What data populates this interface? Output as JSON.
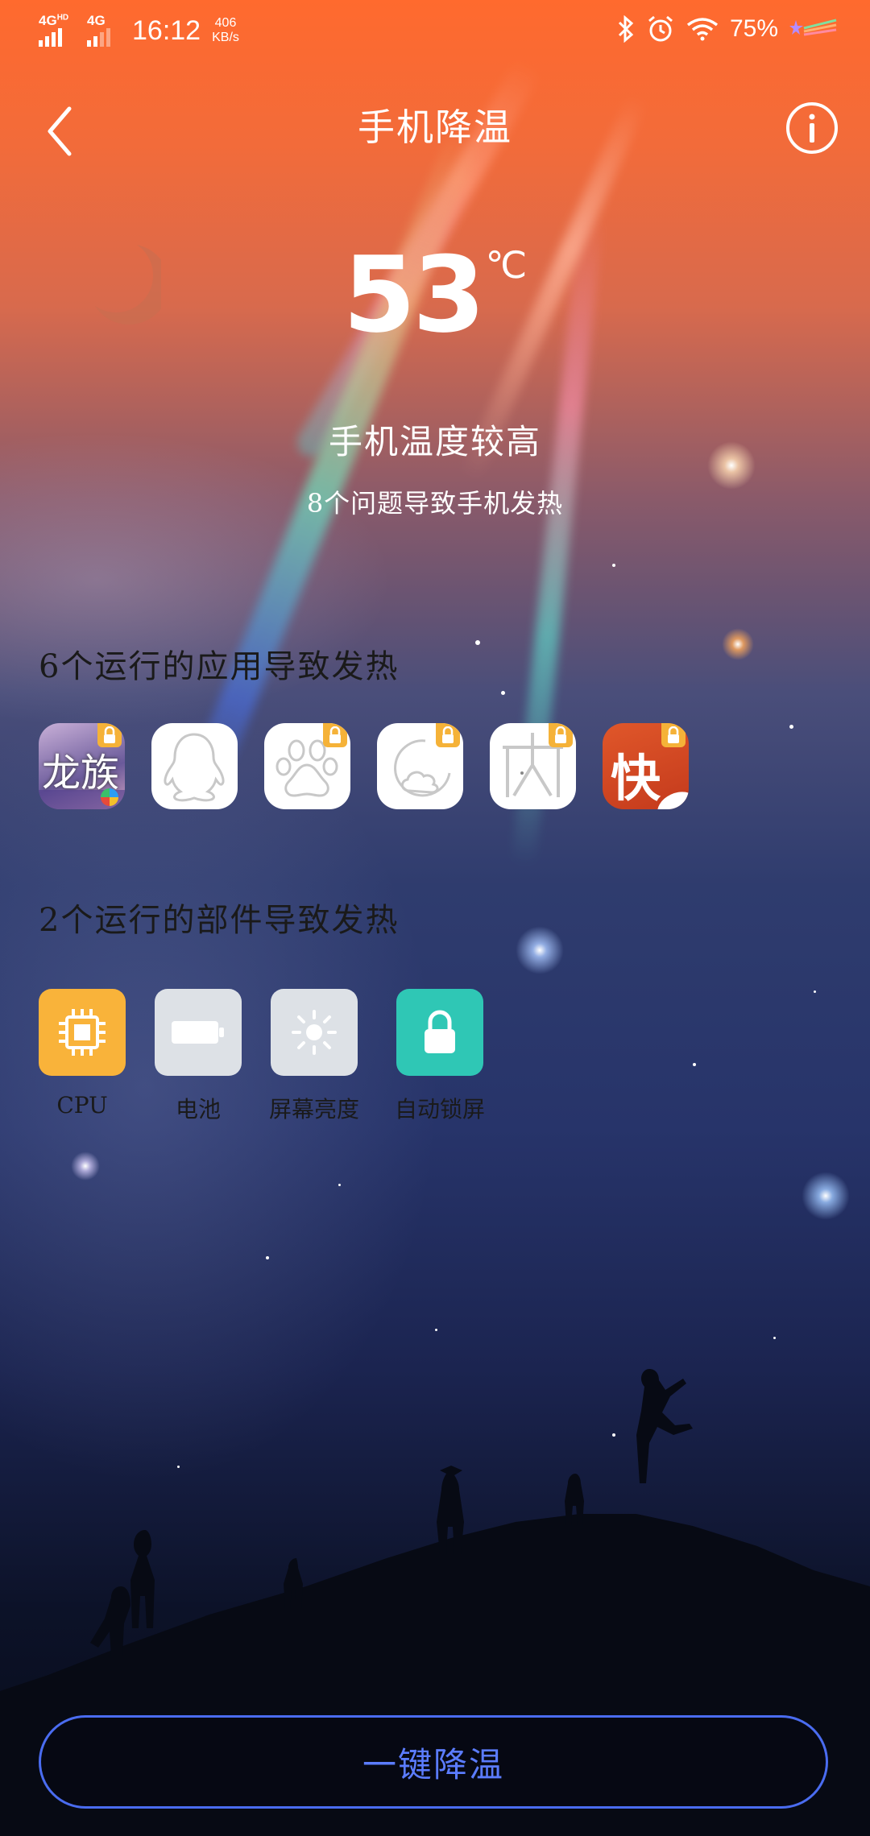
{
  "status_bar": {
    "net1": "4G",
    "net1_sup": "HD",
    "net2": "4G",
    "time": "16:12",
    "speed_value": "406",
    "speed_unit": "KB/s",
    "battery": "75%"
  },
  "header": {
    "title": "手机降温"
  },
  "temperature": {
    "value": "53",
    "unit": "℃"
  },
  "status": {
    "headline": "手机温度较高",
    "subline": "8个问题导致手机发热"
  },
  "apps_section": {
    "title": "6个运行的应用导致发热",
    "apps": [
      {
        "icon": "game-app-icon",
        "locked": true,
        "text": "龙族"
      },
      {
        "icon": "qq-penguin-icon",
        "locked": false
      },
      {
        "icon": "baidu-paw-icon",
        "locked": true
      },
      {
        "icon": "cloud-app-icon",
        "locked": true
      },
      {
        "icon": "quark-app-icon",
        "locked": true
      },
      {
        "icon": "kuai-app-icon",
        "locked": true,
        "text": "快"
      }
    ]
  },
  "components_section": {
    "title": "2个运行的部件导致发热",
    "items": [
      {
        "label": "CPU",
        "icon": "cpu-icon",
        "color": "#f9b33a"
      },
      {
        "label": "电池",
        "icon": "battery-icon",
        "color": "#dde1e6"
      },
      {
        "label": "屏幕亮度",
        "icon": "brightness-icon",
        "color": "#dde1e6"
      },
      {
        "label": "自动锁屏",
        "icon": "lock-icon",
        "color": "#2fc7b5"
      }
    ]
  },
  "action": {
    "label": "一键降温"
  },
  "colors": {
    "accent": "#5b7cff",
    "top_gradient": "#ff6a2e"
  }
}
